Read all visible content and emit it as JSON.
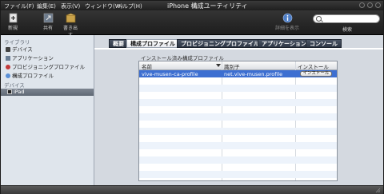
{
  "window": {
    "title": "iPhone 構成ユーティリティ"
  },
  "menu": [
    "ファイル(F)",
    "編集(E)",
    "表示(V)",
    "ウィンドウ(W)",
    "ヘルプ(H)"
  ],
  "toolbar": {
    "new_label": "新規",
    "share_label": "共有",
    "export_label": "書き出す",
    "details_label": "詳細を表示",
    "search_placeholder": "",
    "search_label": "検索"
  },
  "sidebar": {
    "library_heading": "ライブラリ",
    "library_items": [
      "デバイス",
      "アプリケーション",
      "プロビジョニングプロファイル",
      "構成プロファイル"
    ],
    "devices_heading": "デバイス",
    "device_items": [
      "iPad"
    ]
  },
  "tabs": [
    "概要",
    "構成プロファイル",
    "プロビジョニングプロファイル",
    "アプリケーション",
    "コンソール"
  ],
  "main": {
    "section_label": "インストール済み構成プロファイル",
    "columns": [
      "名前",
      "識別子",
      "インストール"
    ],
    "rows": [
      {
        "name": "vive-musen-ca-profile",
        "identifier": "net.vive-musen.profile",
        "action": "インストール"
      }
    ]
  },
  "colors": {
    "selection": "#3d6fd1",
    "toolbar": "#262626",
    "tab_active": "#ffffff"
  }
}
